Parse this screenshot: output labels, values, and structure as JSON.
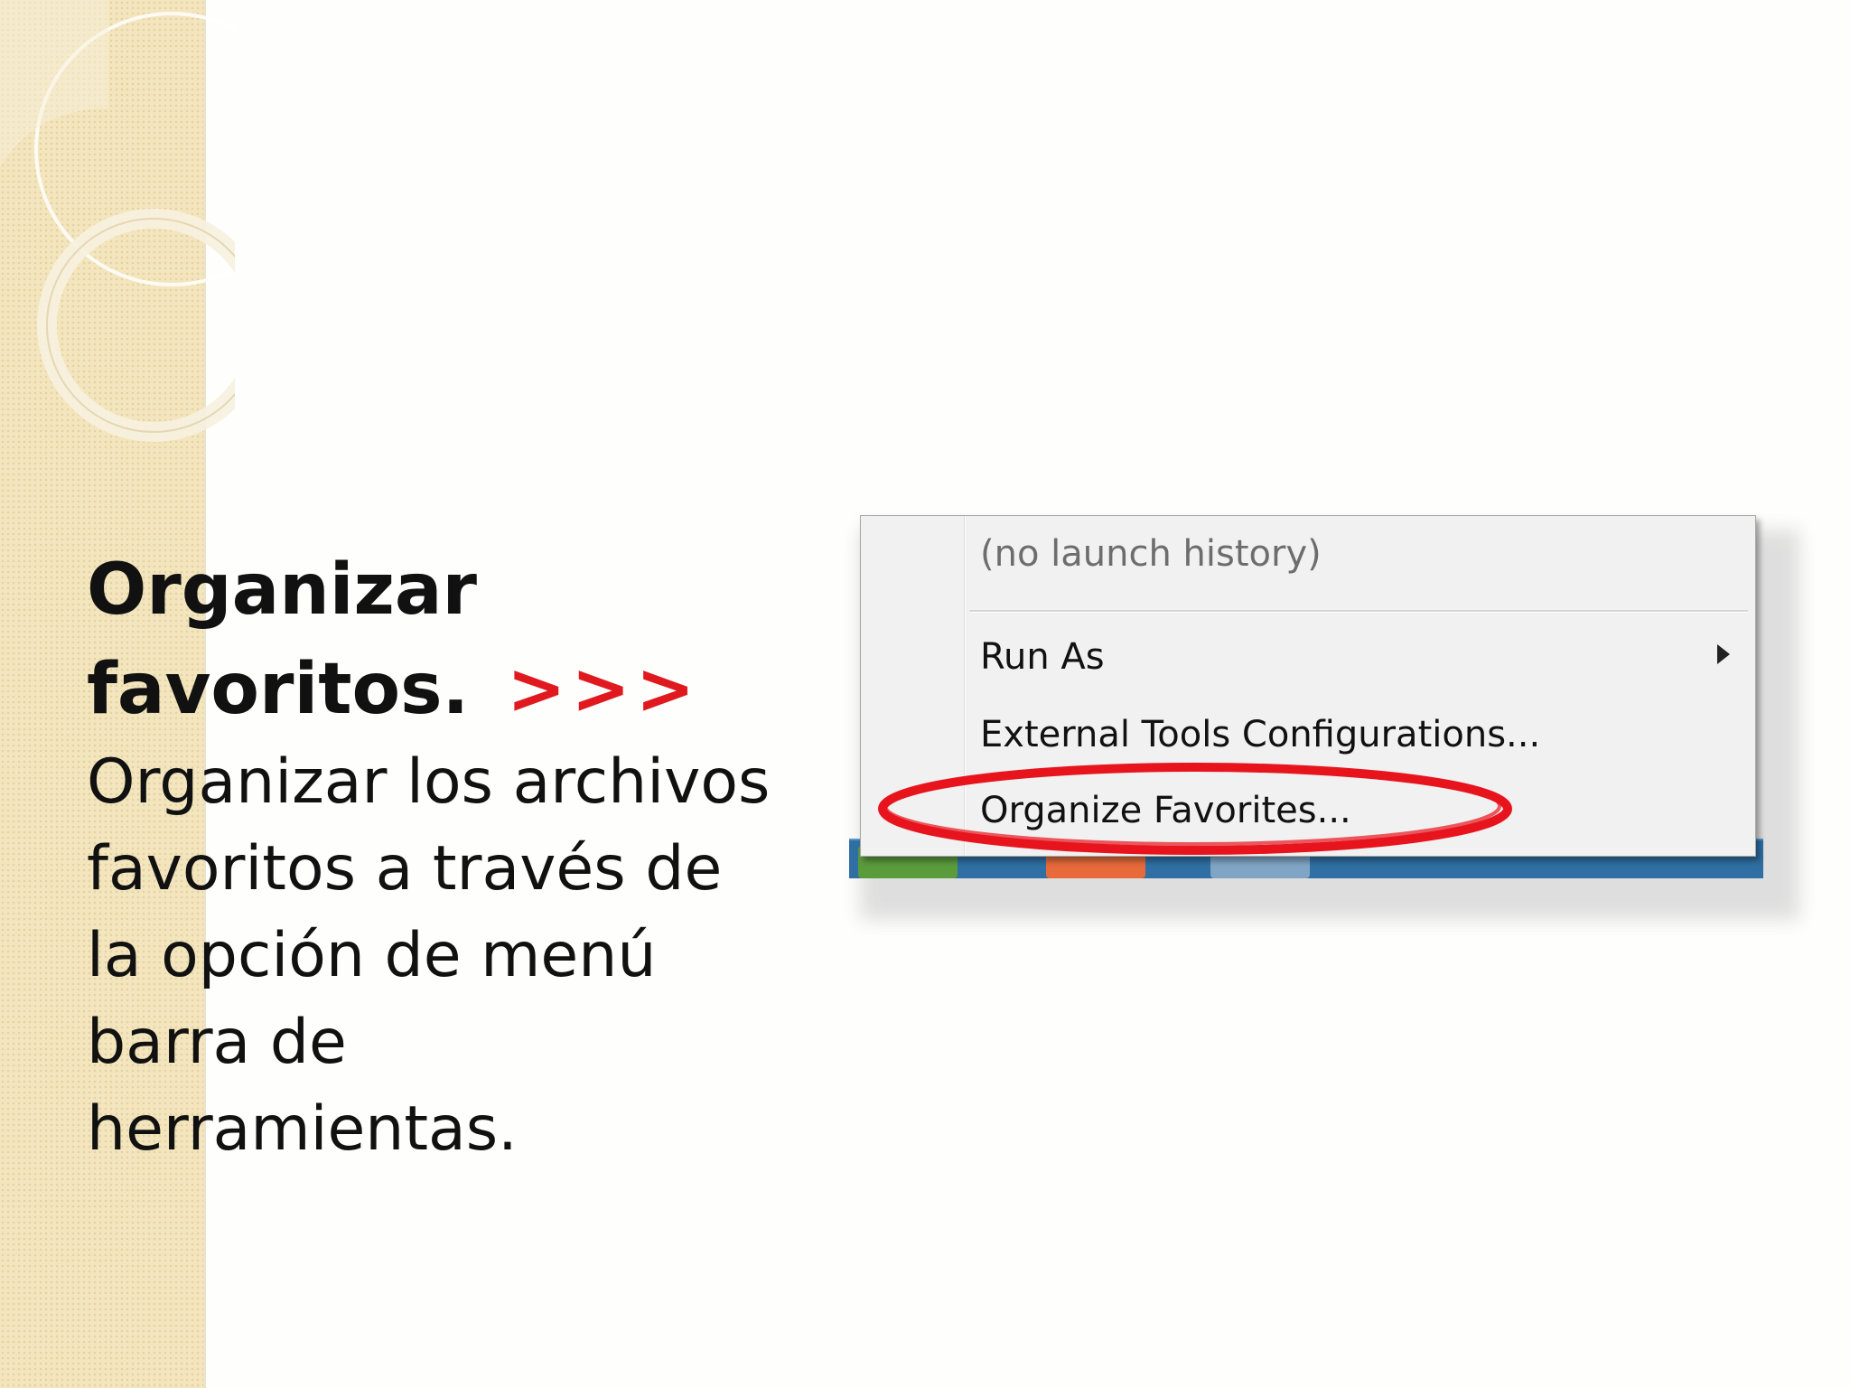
{
  "slide": {
    "title_line1": "Organizar",
    "title_line2": "favoritos.",
    "title_arrows": ">>>",
    "body": "Organizar los archivos favoritos a través de la opción de menú barra de herramientas."
  },
  "menu": {
    "history_item": "(no launch history)",
    "run_as": "Run As",
    "external_tools": "External Tools Configurations...",
    "organize_favorites": "Organize Favorites..."
  },
  "colors": {
    "accent_arrows": "#e0191f",
    "highlight_ring": "#e8141d",
    "side_stripe": "#f3e5bd",
    "taskbar": "#2f6fa3"
  },
  "icons": [
    "submenu-arrow-icon",
    "highlight-ring-icon"
  ]
}
